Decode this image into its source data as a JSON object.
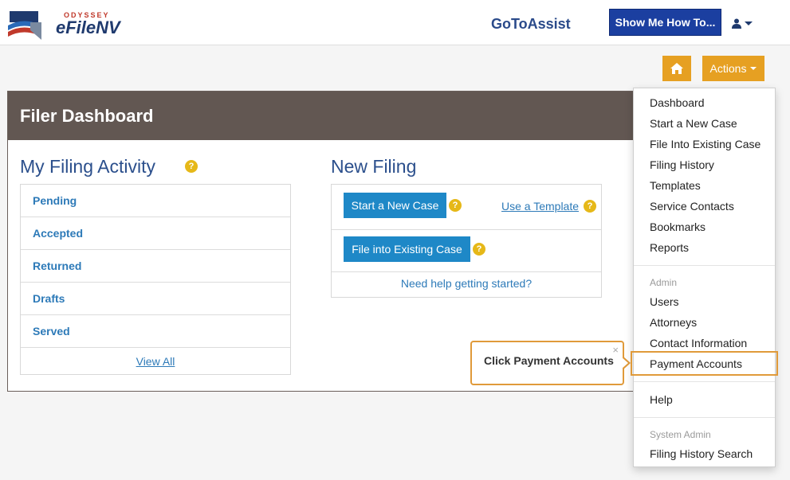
{
  "header": {
    "logo_small": "ODYSSEY",
    "logo_big": "eFileNV",
    "gotoassist": "GoToAssist",
    "showme_label": "Show Me How To..."
  },
  "toolbar": {
    "actions_label": "Actions"
  },
  "dashboard": {
    "title": "Filer Dashboard",
    "activity": {
      "title": "My Filing Activity",
      "help": "?",
      "items": [
        "Pending",
        "Accepted",
        "Returned",
        "Drafts",
        "Served"
      ],
      "view_all": "View All"
    },
    "new_filing": {
      "title": "New Filing",
      "start_new_case": "Start a New Case",
      "use_template": "Use a Template",
      "file_existing": "File into Existing Case",
      "need_help": "Need help getting started?",
      "help": "?"
    }
  },
  "actions_menu": {
    "items_main": [
      "Dashboard",
      "Start a New Case",
      "File Into Existing Case",
      "Filing History",
      "Templates",
      "Service Contacts",
      "Bookmarks",
      "Reports"
    ],
    "admin_header": "Admin",
    "items_admin": [
      "Users",
      "Attorneys",
      "Contact Information",
      "Payment Accounts"
    ],
    "help": "Help",
    "system_admin_header": "System Admin",
    "items_system_admin": [
      "Filing History Search"
    ]
  },
  "tooltip": {
    "text": "Click Payment Accounts",
    "close": "×"
  },
  "colors": {
    "accent_orange": "#e6a022",
    "brand_blue": "#1b3fa0",
    "button_blue": "#1e88c7",
    "header_brown": "#625752"
  }
}
